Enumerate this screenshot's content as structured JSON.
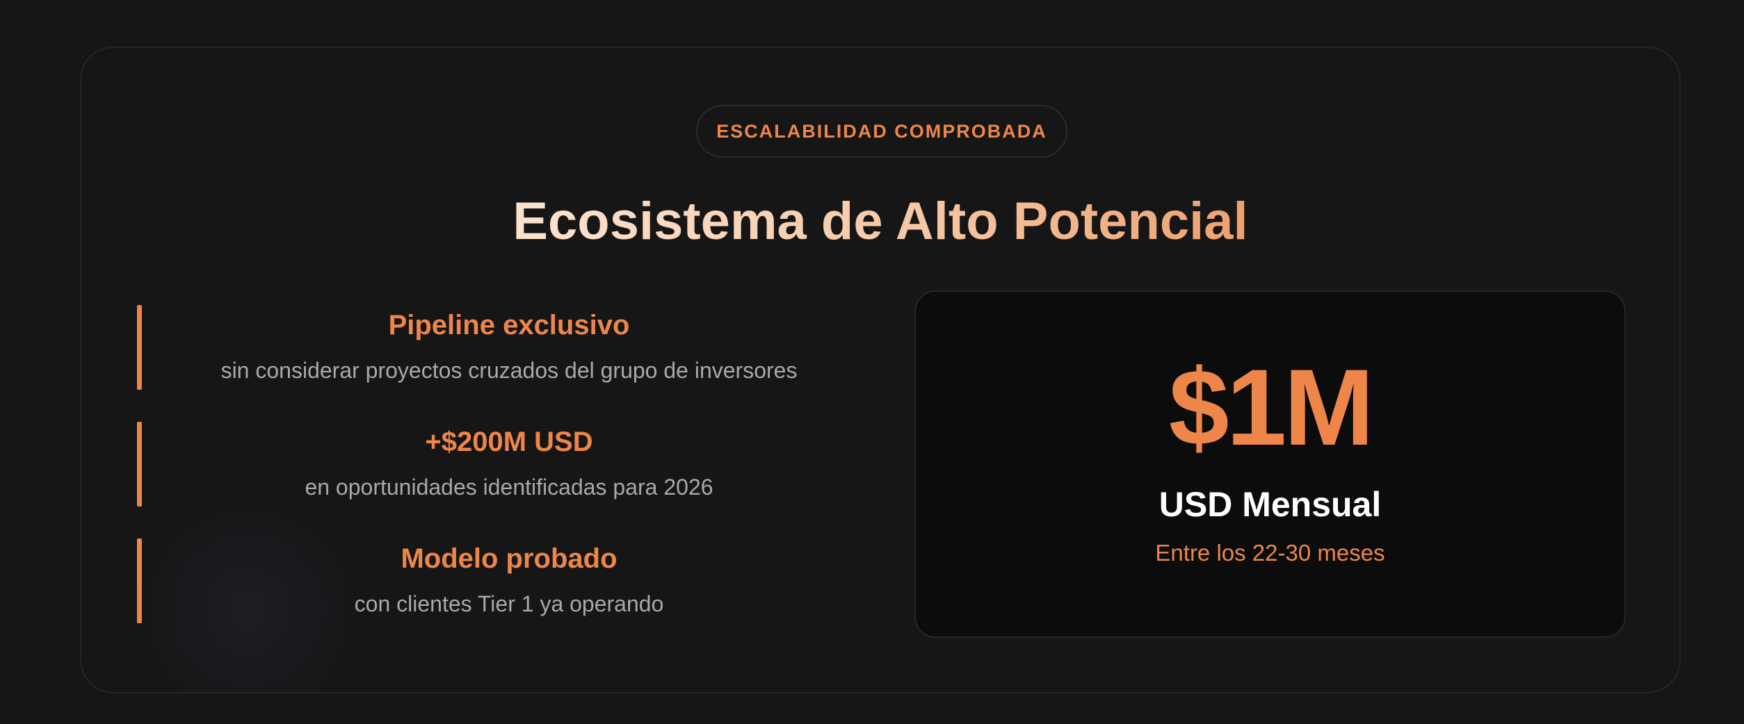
{
  "badge": {
    "label": "ESCALABILIDAD COMPROBADA"
  },
  "heading": {
    "title": "Ecosistema de Alto Potencial"
  },
  "features": [
    {
      "title": "Pipeline exclusivo",
      "description": "sin considerar proyectos cruzados del grupo de inversores"
    },
    {
      "title": "+$200M USD",
      "description": "en oportunidades identificadas para 2026"
    },
    {
      "title": "Modelo probado",
      "description": "con clientes Tier 1 ya operando"
    }
  ],
  "metric": {
    "value": "$1M",
    "unit": "USD Mensual",
    "note": "Entre los 22-30 meses"
  },
  "colors": {
    "background": "#161616",
    "accent": "#ee864a",
    "panel": "#0c0c0c",
    "muted_text": "#a9a9a9"
  }
}
